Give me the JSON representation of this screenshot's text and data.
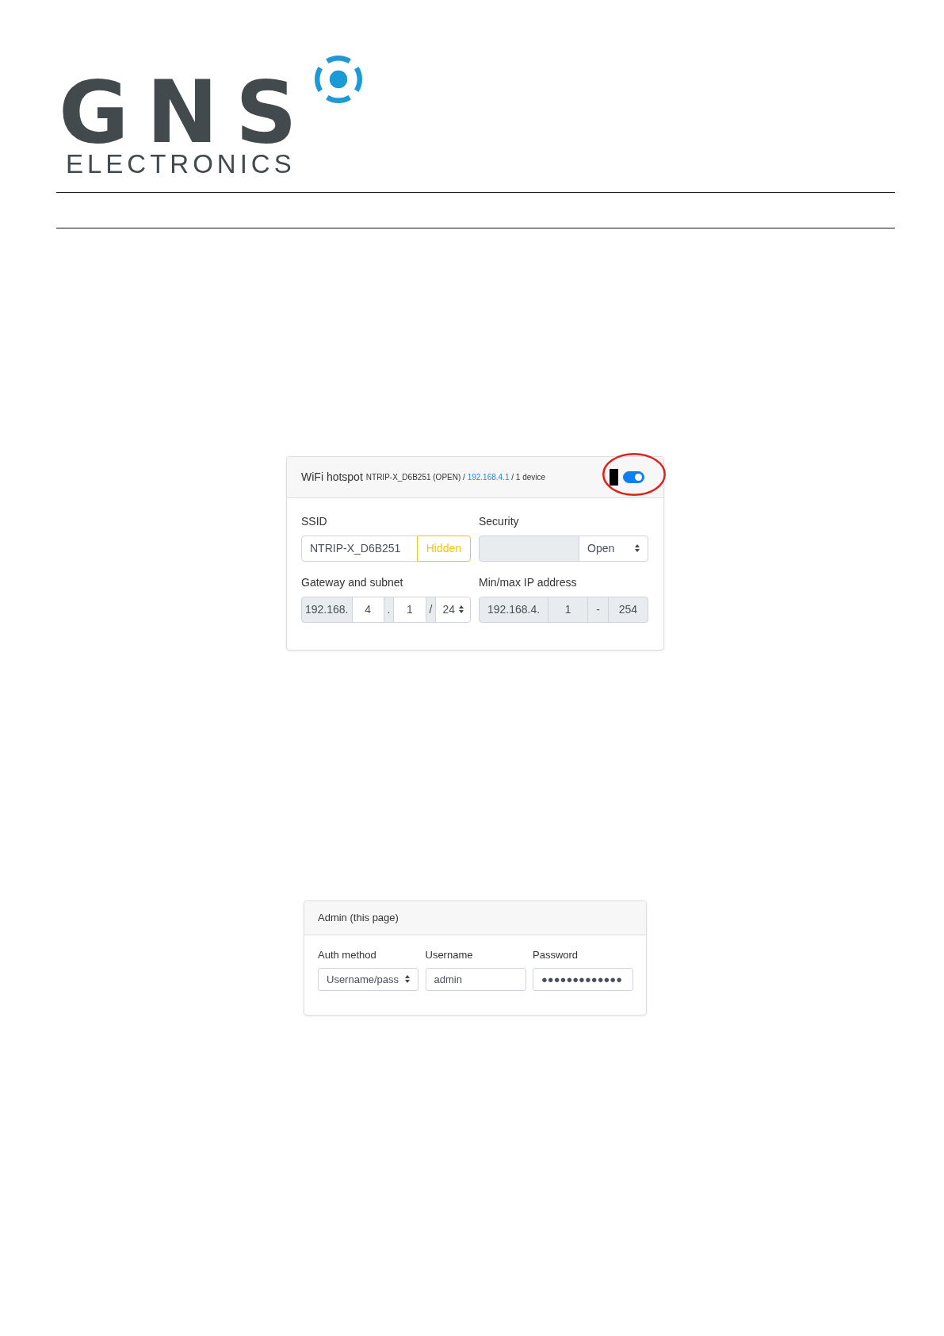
{
  "logo": {
    "wordmark": "GNS",
    "subtitle": "ELECTRONICS"
  },
  "wifi_panel": {
    "title": "WiFi hotspot",
    "status": {
      "before_link": "NTRIP-X_D6B251 (OPEN) /",
      "link": "192.168.4.1",
      "after_link": "/ 1 device"
    },
    "toggle": {
      "on": true,
      "circled": true
    },
    "groups": [
      {
        "label": "SSID",
        "parts": [
          {
            "kind": "input",
            "value": "NTRIP-X_D6B251",
            "disabled": false
          },
          {
            "kind": "button",
            "label": "Hidden"
          }
        ]
      },
      {
        "label": "Security",
        "parts": [
          {
            "kind": "input",
            "disabled": true
          },
          {
            "kind": "select",
            "value": "Open"
          }
        ]
      },
      {
        "label": "Gateway and subnet",
        "parts": [
          {
            "kind": "addon",
            "text": "192.168."
          },
          {
            "kind": "input",
            "value": "4",
            "disabled": false
          },
          {
            "kind": "addon",
            "text": "."
          },
          {
            "kind": "input",
            "value": "1",
            "disabled": false
          },
          {
            "kind": "addon",
            "text": "/"
          },
          {
            "kind": "select",
            "value": "24"
          }
        ]
      },
      {
        "label": "Min/max IP address",
        "parts": [
          {
            "kind": "addon",
            "text": "192.168.4."
          },
          {
            "kind": "input",
            "value": "1",
            "disabled": true
          },
          {
            "kind": "addon",
            "text": "-"
          },
          {
            "kind": "input",
            "value": "254",
            "disabled": true
          }
        ]
      }
    ]
  },
  "admin_panel": {
    "title": "Admin (this page)",
    "fields": [
      {
        "kind": "select",
        "label": "Auth method",
        "value": "Username/pass"
      },
      {
        "kind": "input",
        "label": "Username",
        "value": "admin"
      },
      {
        "kind": "input",
        "label": "Password",
        "value": "●●●●●●●●●●●●●"
      }
    ]
  }
}
